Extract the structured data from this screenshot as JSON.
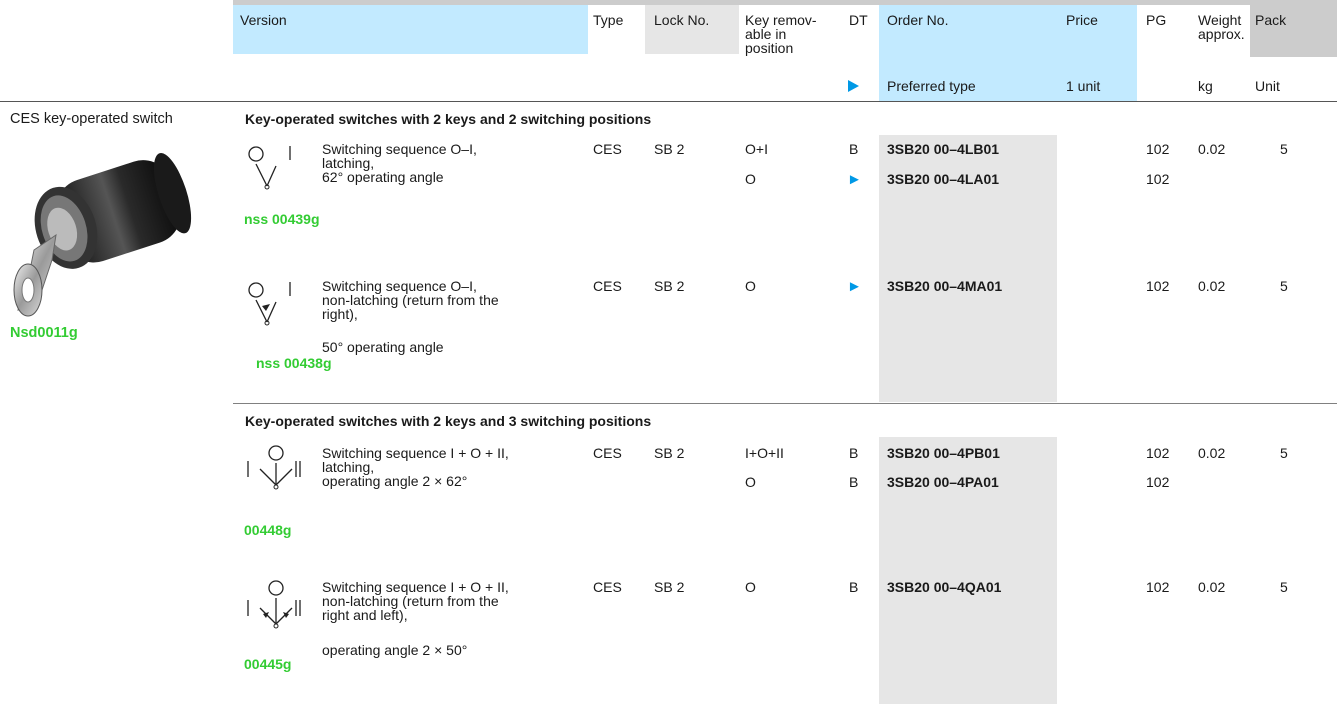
{
  "header": {
    "version": "Version",
    "type": "Type",
    "lock_no": "Lock No.",
    "key_removable_line1": "Key remov-",
    "key_removable_line2": "able in",
    "key_removable_line3": "position",
    "dt": "DT",
    "order_no": "Order No.",
    "price": "Price",
    "pg": "PG",
    "weight_line1": "Weight",
    "weight_line2": "approx.",
    "pack": "Pack",
    "preferred_type": "Preferred type",
    "price_unit": "1 unit",
    "weight_unit": "kg",
    "pack_unit": "Unit"
  },
  "product": {
    "label": "CES key-operated switch",
    "image_code": "Nsd0011g"
  },
  "sections": [
    {
      "title": "Key-operated switches with 2 keys and 2 switching positions",
      "items": [
        {
          "diagram_code": "nss 00439g",
          "desc": [
            "Switching sequence O–I,",
            "latching,",
            "62° operating angle"
          ],
          "type": "CES",
          "lock": "SB 2",
          "rows": [
            {
              "key": "O+I",
              "dt": "B",
              "order": "3SB20 00–4LB01",
              "pg": "102",
              "weight": "0.02",
              "pack": "5"
            },
            {
              "key": "O",
              "dt": "►",
              "order": "3SB20 00–4LA01",
              "pg": "102",
              "weight": "",
              "pack": ""
            }
          ]
        },
        {
          "diagram_code": "nss 00438g",
          "desc": [
            "Switching sequence O–I,",
            "non-latching (return from the",
            "right),",
            "50° operating angle"
          ],
          "type": "CES",
          "lock": "SB 2",
          "rows": [
            {
              "key": "O",
              "dt": "►",
              "order": "3SB20 00–4MA01",
              "pg": "102",
              "weight": "0.02",
              "pack": "5"
            }
          ]
        }
      ]
    },
    {
      "title": "Key-operated switches with 2 keys and 3 switching positions",
      "items": [
        {
          "diagram_code": "00448g",
          "desc": [
            "Switching sequence I + O + II,",
            "latching,",
            "operating angle 2 ×  62°"
          ],
          "type": "CES",
          "lock": "SB 2",
          "rows": [
            {
              "key": "I+O+II",
              "dt": "B",
              "order": "3SB20 00–4PB01",
              "pg": "102",
              "weight": "0.02",
              "pack": "5"
            },
            {
              "key": "O",
              "dt": "B",
              "order": "3SB20 00–4PA01",
              "pg": "102",
              "weight": "",
              "pack": ""
            }
          ]
        },
        {
          "diagram_code": "00445g",
          "desc": [
            "Switching sequence I + O + II,",
            "non-latching (return from the",
            "right and left),",
            "operating angle 2 × 50°"
          ],
          "type": "CES",
          "lock": "SB 2",
          "rows": [
            {
              "key": "O",
              "dt": "B",
              "order": "3SB20 00–4QA01",
              "pg": "102",
              "weight": "0.02",
              "pack": "5"
            }
          ]
        }
      ]
    }
  ],
  "diagram_labels": {
    "off": "O",
    "pos1": "I",
    "pos2": "II"
  },
  "colors": {
    "header_blue": "#c2eaff",
    "grey": "#e6e6e6",
    "accent_blue": "#0099e6",
    "code_green": "#33cc33"
  }
}
